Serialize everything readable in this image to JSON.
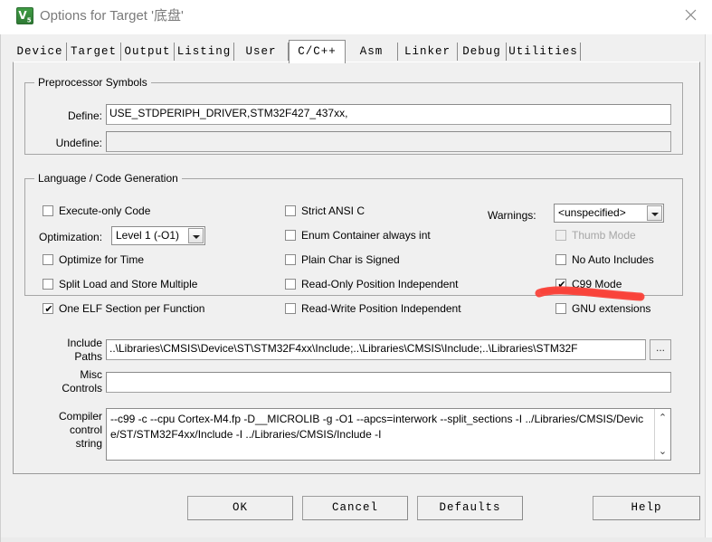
{
  "window": {
    "title": "Options for Target '底盘'",
    "icon": "keil-uvision-icon",
    "close_label": "✕"
  },
  "tabs": [
    {
      "label": "Device",
      "active": false
    },
    {
      "label": "Target",
      "active": false
    },
    {
      "label": "Output",
      "active": false
    },
    {
      "label": "Listing",
      "active": false
    },
    {
      "label": "User",
      "active": false
    },
    {
      "label": "C/C++",
      "active": true
    },
    {
      "label": "Asm",
      "active": false
    },
    {
      "label": "Linker",
      "active": false
    },
    {
      "label": "Debug",
      "active": false
    },
    {
      "label": "Utilities",
      "active": false
    }
  ],
  "preprocessor": {
    "legend": "Preprocessor Symbols",
    "define_label": "Define:",
    "define_value": "USE_STDPERIPH_DRIVER,STM32F427_437xx,",
    "undefine_label": "Undefine:",
    "undefine_value": ""
  },
  "language": {
    "legend": "Language / Code Generation",
    "col1": [
      {
        "label": "Execute-only Code",
        "checked": false,
        "disabled": false
      },
      {
        "label": "Optimize for Time",
        "checked": false,
        "disabled": false
      },
      {
        "label": "Split Load and Store Multiple",
        "checked": false,
        "disabled": false
      },
      {
        "label": "One ELF Section per Function",
        "checked": true,
        "disabled": false
      }
    ],
    "optimization_label": "Optimization:",
    "optimization_value": "Level 1 (-O1)",
    "col2": [
      {
        "label": "Strict ANSI C",
        "checked": false,
        "disabled": false
      },
      {
        "label": "Enum Container always int",
        "checked": false,
        "disabled": false
      },
      {
        "label": "Plain Char is Signed",
        "checked": false,
        "disabled": false
      },
      {
        "label": "Read-Only Position Independent",
        "checked": false,
        "disabled": false
      },
      {
        "label": "Read-Write Position Independent",
        "checked": false,
        "disabled": false
      }
    ],
    "warnings_label": "Warnings:",
    "warnings_value": "<unspecified>",
    "col3": [
      {
        "label": "Thumb Mode",
        "checked": false,
        "disabled": true
      },
      {
        "label": "No Auto Includes",
        "checked": false,
        "disabled": false
      },
      {
        "label": "C99 Mode",
        "checked": true,
        "disabled": false
      },
      {
        "label": "GNU extensions",
        "checked": false,
        "disabled": false
      }
    ]
  },
  "paths": {
    "include_label_line1": "Include",
    "include_label_line2": "Paths",
    "include_value": "..\\Libraries\\CMSIS\\Device\\ST\\STM32F4xx\\Include;..\\Libraries\\CMSIS\\Include;..\\Libraries\\STM32F",
    "browse_label": "...",
    "misc_label_line1": "Misc",
    "misc_label_line2": "Controls",
    "misc_value": ""
  },
  "compiler": {
    "label_line1": "Compiler",
    "label_line2": "control",
    "label_line3": "string",
    "value": "--c99 -c --cpu Cortex-M4.fp -D__MICROLIB -g -O1 --apcs=interwork --split_sections -I ../Libraries/CMSIS/Device/ST/STM32F4xx/Include -I ../Libraries/CMSIS/Include -I",
    "scroll_up": "⌃",
    "scroll_down": "⌄"
  },
  "buttons": [
    {
      "label": "OK",
      "name": "ok-button"
    },
    {
      "label": "Cancel",
      "name": "cancel-button"
    },
    {
      "label": "Defaults",
      "name": "defaults-button"
    },
    {
      "label": "Help",
      "name": "help-button"
    }
  ],
  "annotation": {
    "type": "red-underline-stroke",
    "color": "#F9423A",
    "target": "C99 Mode"
  }
}
